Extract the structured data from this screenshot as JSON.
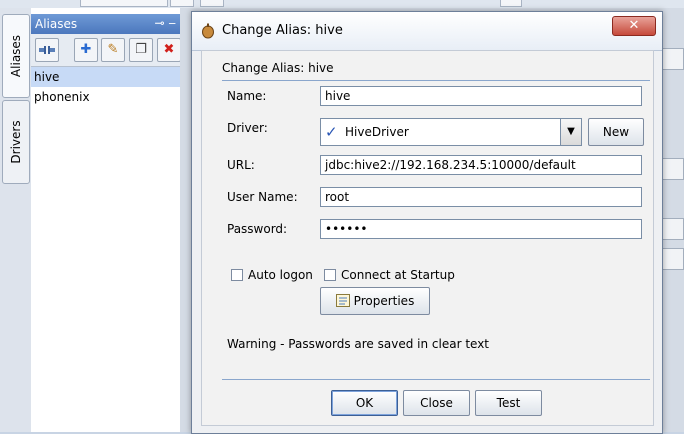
{
  "side_tabs": [
    "Aliases",
    "Drivers"
  ],
  "aliases_panel": {
    "title": "Aliases",
    "header_icons": "⊸ ‒",
    "toolbar": {
      "connect_icon": "connect-icon",
      "add_icon": "plus-icon",
      "edit_icon": "pencil-icon",
      "copy_icon": "copy-icon",
      "delete_icon": "x-icon"
    },
    "items": [
      "hive",
      "phonenix"
    ]
  },
  "dialog": {
    "title": "Change Alias: hive",
    "close_label": "✕",
    "header": "Change Alias: hive",
    "fields": {
      "name": {
        "label": "Name:",
        "value": "hive"
      },
      "driver": {
        "label": "Driver:",
        "value": "HiveDriver"
      },
      "url": {
        "label": "URL:",
        "value": "jdbc:hive2://192.168.234.5:10000/default"
      },
      "user": {
        "label": "User Name:",
        "value": "root"
      },
      "password": {
        "label": "Password:",
        "value": "••••••"
      }
    },
    "new_button": "New",
    "auto_logon": {
      "label": "Auto logon",
      "checked": false
    },
    "connect_at_startup": {
      "label": "Connect at Startup",
      "checked": false
    },
    "properties_button": "Properties",
    "warning": "Warning - Passwords are saved in clear text",
    "buttons": {
      "ok": "OK",
      "close": "Close",
      "test": "Test"
    }
  },
  "colors": {
    "accent": "#4b77bd",
    "selection": "#c7daf6",
    "close_button": "#c64a3b"
  }
}
